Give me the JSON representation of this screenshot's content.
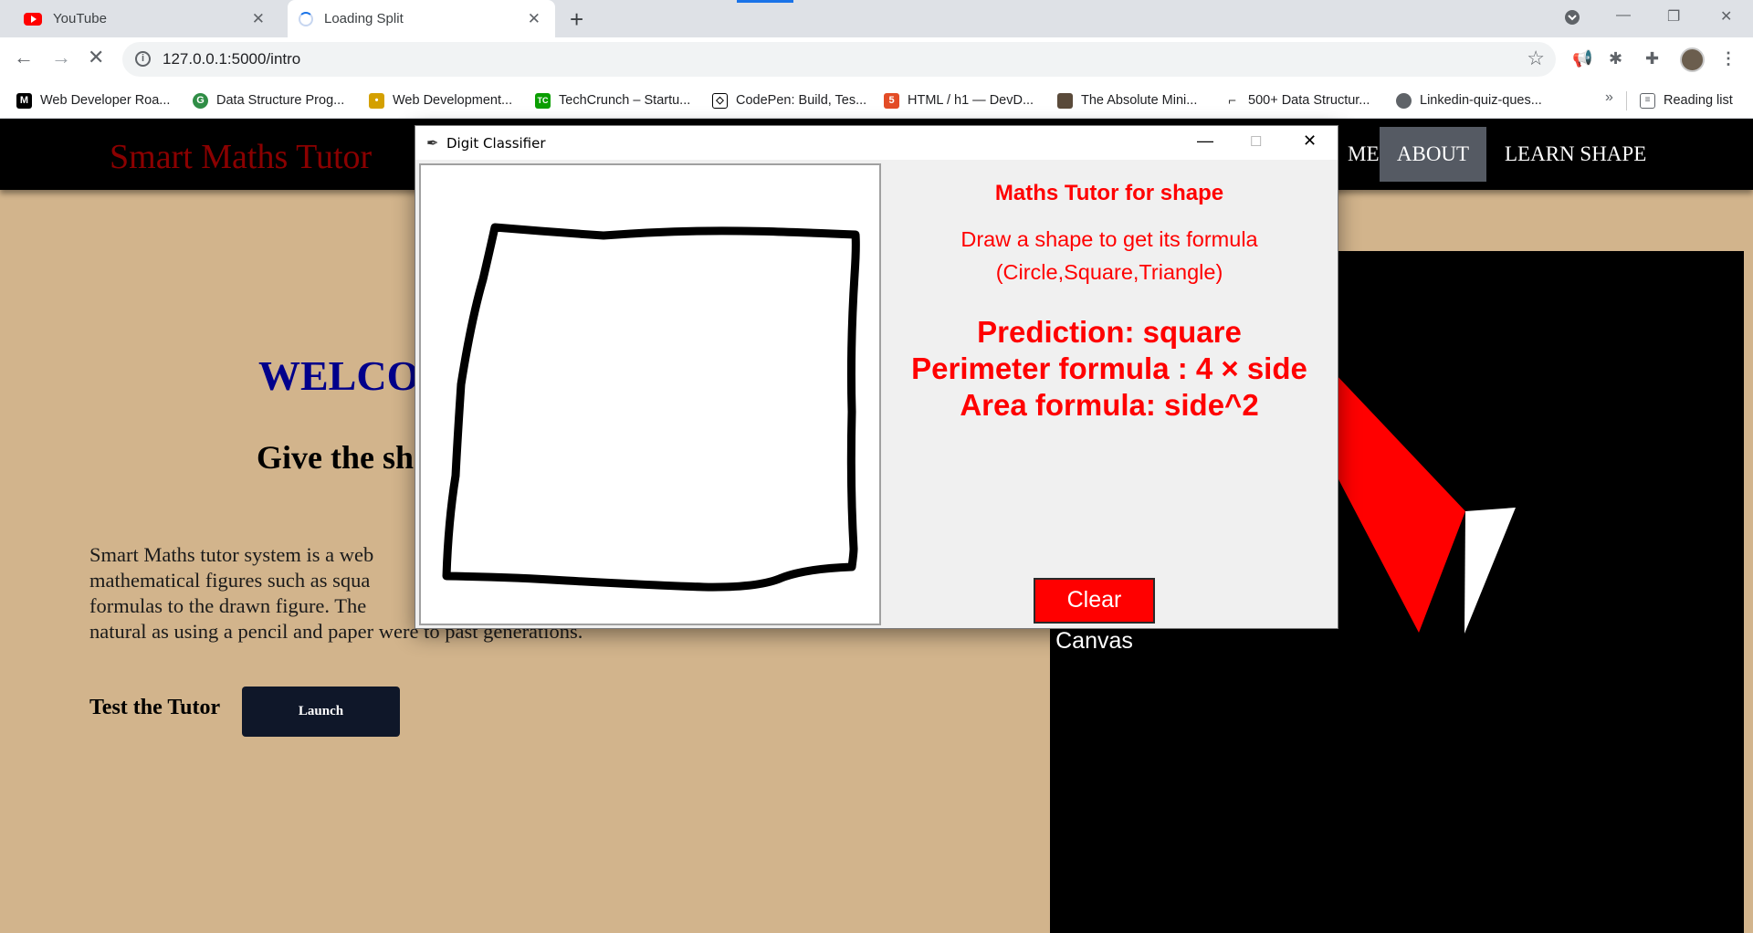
{
  "browser": {
    "tabs": [
      {
        "title": "YouTube",
        "icon": "youtube-icon"
      },
      {
        "title": "Loading Split",
        "icon": "loading-spinner-icon"
      }
    ],
    "url": "127.0.0.1:5000/intro",
    "bookmarks": [
      {
        "label": "Web Developer Roa...",
        "icon": "medium-icon",
        "color": "#000000"
      },
      {
        "label": "Data Structure Prog...",
        "icon": "geeks-icon",
        "color": "#2f8d46"
      },
      {
        "label": "Web Development...",
        "icon": "bulb-icon",
        "color": "#d4a000"
      },
      {
        "label": "TechCrunch – Startu...",
        "icon": "techcrunch-icon",
        "color": "#0a9e01"
      },
      {
        "label": "CodePen: Build, Tes...",
        "icon": "codepen-icon",
        "color": "#000000"
      },
      {
        "label": "HTML / h1 — DevD...",
        "icon": "html5-icon",
        "color": "#e34c26"
      },
      {
        "label": "The Absolute Mini...",
        "icon": "person-icon",
        "color": "#5a4a3a"
      },
      {
        "label": "500+ Data Structur...",
        "icon": "bracket-icon",
        "color": "#333333"
      },
      {
        "label": "Linkedin-quiz-ques...",
        "icon": "globe-icon",
        "color": "#5f6368"
      }
    ],
    "reading_list": "Reading list",
    "more": "»"
  },
  "site": {
    "brand": "Smart Maths Tutor",
    "nav": {
      "home": "ME",
      "about": "ABOUT",
      "learn": "LEARN SHAPE"
    },
    "welcome": "WELCO",
    "subhead": "Give the sh",
    "intro_lines": [
      "Smart Maths tutor system is a web",
      "mathematical figures such as squa",
      "formulas to the drawn figure. The",
      "natural as using a pencil and paper were to past generations."
    ],
    "test_label": "Test the Tutor",
    "launch": "Launch",
    "colors": {
      "brand": "#8b0000",
      "welcome": "#00008b",
      "background": "#d2b48c",
      "art_red": "#ff0000"
    }
  },
  "dialog": {
    "title": "Digit Classifier",
    "heading": "Maths Tutor for shape",
    "instruction_1": "Draw a shape to get its formula",
    "instruction_2": "(Circle,Square,Triangle)",
    "prediction": "Prediction: square",
    "perimeter": "Perimeter formula : 4 × side",
    "area": "Area formula: side^2",
    "clear_button": "Clear Canvas",
    "text_color": "#ff0000"
  }
}
